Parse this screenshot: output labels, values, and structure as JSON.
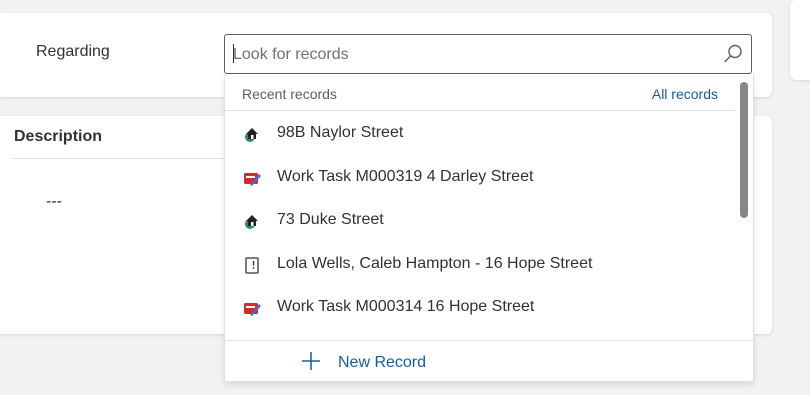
{
  "regarding": {
    "label": "Regarding",
    "lookup": {
      "placeholder": "Look for records",
      "value": ""
    }
  },
  "description": {
    "title": "Description",
    "value": "---"
  },
  "flyout": {
    "recent_label": "Recent records",
    "all_records_label": "All records",
    "items": [
      {
        "label": "98B Naylor Street",
        "icon": "property-icon"
      },
      {
        "label": "Work Task M000319 4 Darley Street",
        "icon": "work-task-icon"
      },
      {
        "label": "73 Duke Street",
        "icon": "property-icon"
      },
      {
        "label": "Lola Wells, Caleb Hampton - 16 Hope Street",
        "icon": "tenancy-icon"
      },
      {
        "label": "Work Task M000314 16 Hope Street",
        "icon": "work-task-icon"
      }
    ],
    "new_record_label": "New Record"
  },
  "colors": {
    "link": "#115ea3",
    "text": "#323130",
    "muted": "#605e5c",
    "border": "#e1dfdd",
    "background": "#f3f2f1"
  }
}
